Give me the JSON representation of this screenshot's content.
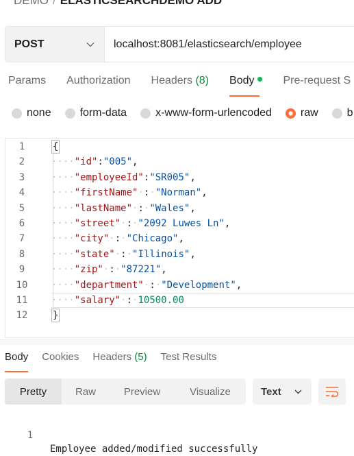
{
  "breadcrumb": {
    "parent": "DEMO",
    "separator": "/",
    "current": "ELASTICSEARCHDEMO ADD"
  },
  "request": {
    "method": "POST",
    "url": "localhost:8081/elasticsearch/employee"
  },
  "request_tabs": {
    "params": "Params",
    "authorization": "Authorization",
    "headers": "Headers",
    "headers_count": "(8)",
    "body": "Body",
    "prerequest": "Pre-request S"
  },
  "body_types": {
    "none": "none",
    "form_data": "form-data",
    "urlencoded": "x-www-form-urlencoded",
    "raw": "raw",
    "binary": "b",
    "selected": "raw"
  },
  "body_lines": [
    {
      "n": "1",
      "key": "",
      "value": ""
    },
    {
      "n": "2",
      "key": "\"id\"",
      "value": "\"005\""
    },
    {
      "n": "3",
      "key": "\"employeeId\"",
      "value": "\"SR005\""
    },
    {
      "n": "4",
      "key": "\"firstName\"",
      "value": "\"Norman\""
    },
    {
      "n": "5",
      "key": "\"lastName\"",
      "value": "\"Wales\""
    },
    {
      "n": "6",
      "key": "\"street\"",
      "value": "\"2092 Luwes Ln\""
    },
    {
      "n": "7",
      "key": "\"city\"",
      "value": "\"Chicago\""
    },
    {
      "n": "8",
      "key": "\"state\"",
      "value": "\"Illinois\""
    },
    {
      "n": "9",
      "key": "\"zip\"",
      "value": "\"87221\""
    },
    {
      "n": "10",
      "key": "\"department\"",
      "value": "\"Development\""
    },
    {
      "n": "11",
      "key": "\"salary\"",
      "value": "10500.00"
    },
    {
      "n": "12",
      "key": "",
      "value": ""
    }
  ],
  "braces": {
    "open": "{",
    "close": "}"
  },
  "response_tabs": {
    "body": "Body",
    "cookies": "Cookies",
    "headers": "Headers",
    "headers_count": "(5)",
    "test_results": "Test Results"
  },
  "view_modes": {
    "pretty": "Pretty",
    "raw": "Raw",
    "preview": "Preview",
    "visualize": "Visualize"
  },
  "format": "Text",
  "response": {
    "line_number": "1",
    "text": "Employee added/modified successfully"
  },
  "colors": {
    "accent": "#ff6c37",
    "count_green": "#0a8a3b",
    "dot_green": "#0cbb52",
    "json_key": "#a31515",
    "json_string": "#0451a5",
    "json_number": "#098658"
  },
  "icons": {
    "method_dropdown": "chevron-down-icon",
    "format_dropdown": "chevron-down-icon",
    "wrap": "wrap-lines-icon"
  }
}
